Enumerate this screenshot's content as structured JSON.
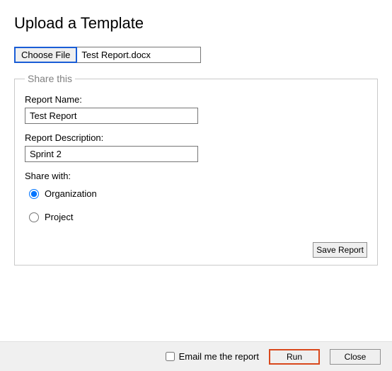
{
  "title": "Upload a Template",
  "file_picker": {
    "button_label": "Choose File",
    "selected_file": "Test Report.docx"
  },
  "share_section": {
    "legend": "Share this",
    "report_name_label": "Report Name:",
    "report_name_value": "Test Report",
    "report_desc_label": "Report Description:",
    "report_desc_value": "Sprint 2",
    "share_with_label": "Share with:",
    "options": {
      "organization": "Organization",
      "project": "Project"
    },
    "save_button": "Save Report"
  },
  "footer": {
    "email_label": "Email me the report",
    "run_label": "Run",
    "close_label": "Close"
  }
}
